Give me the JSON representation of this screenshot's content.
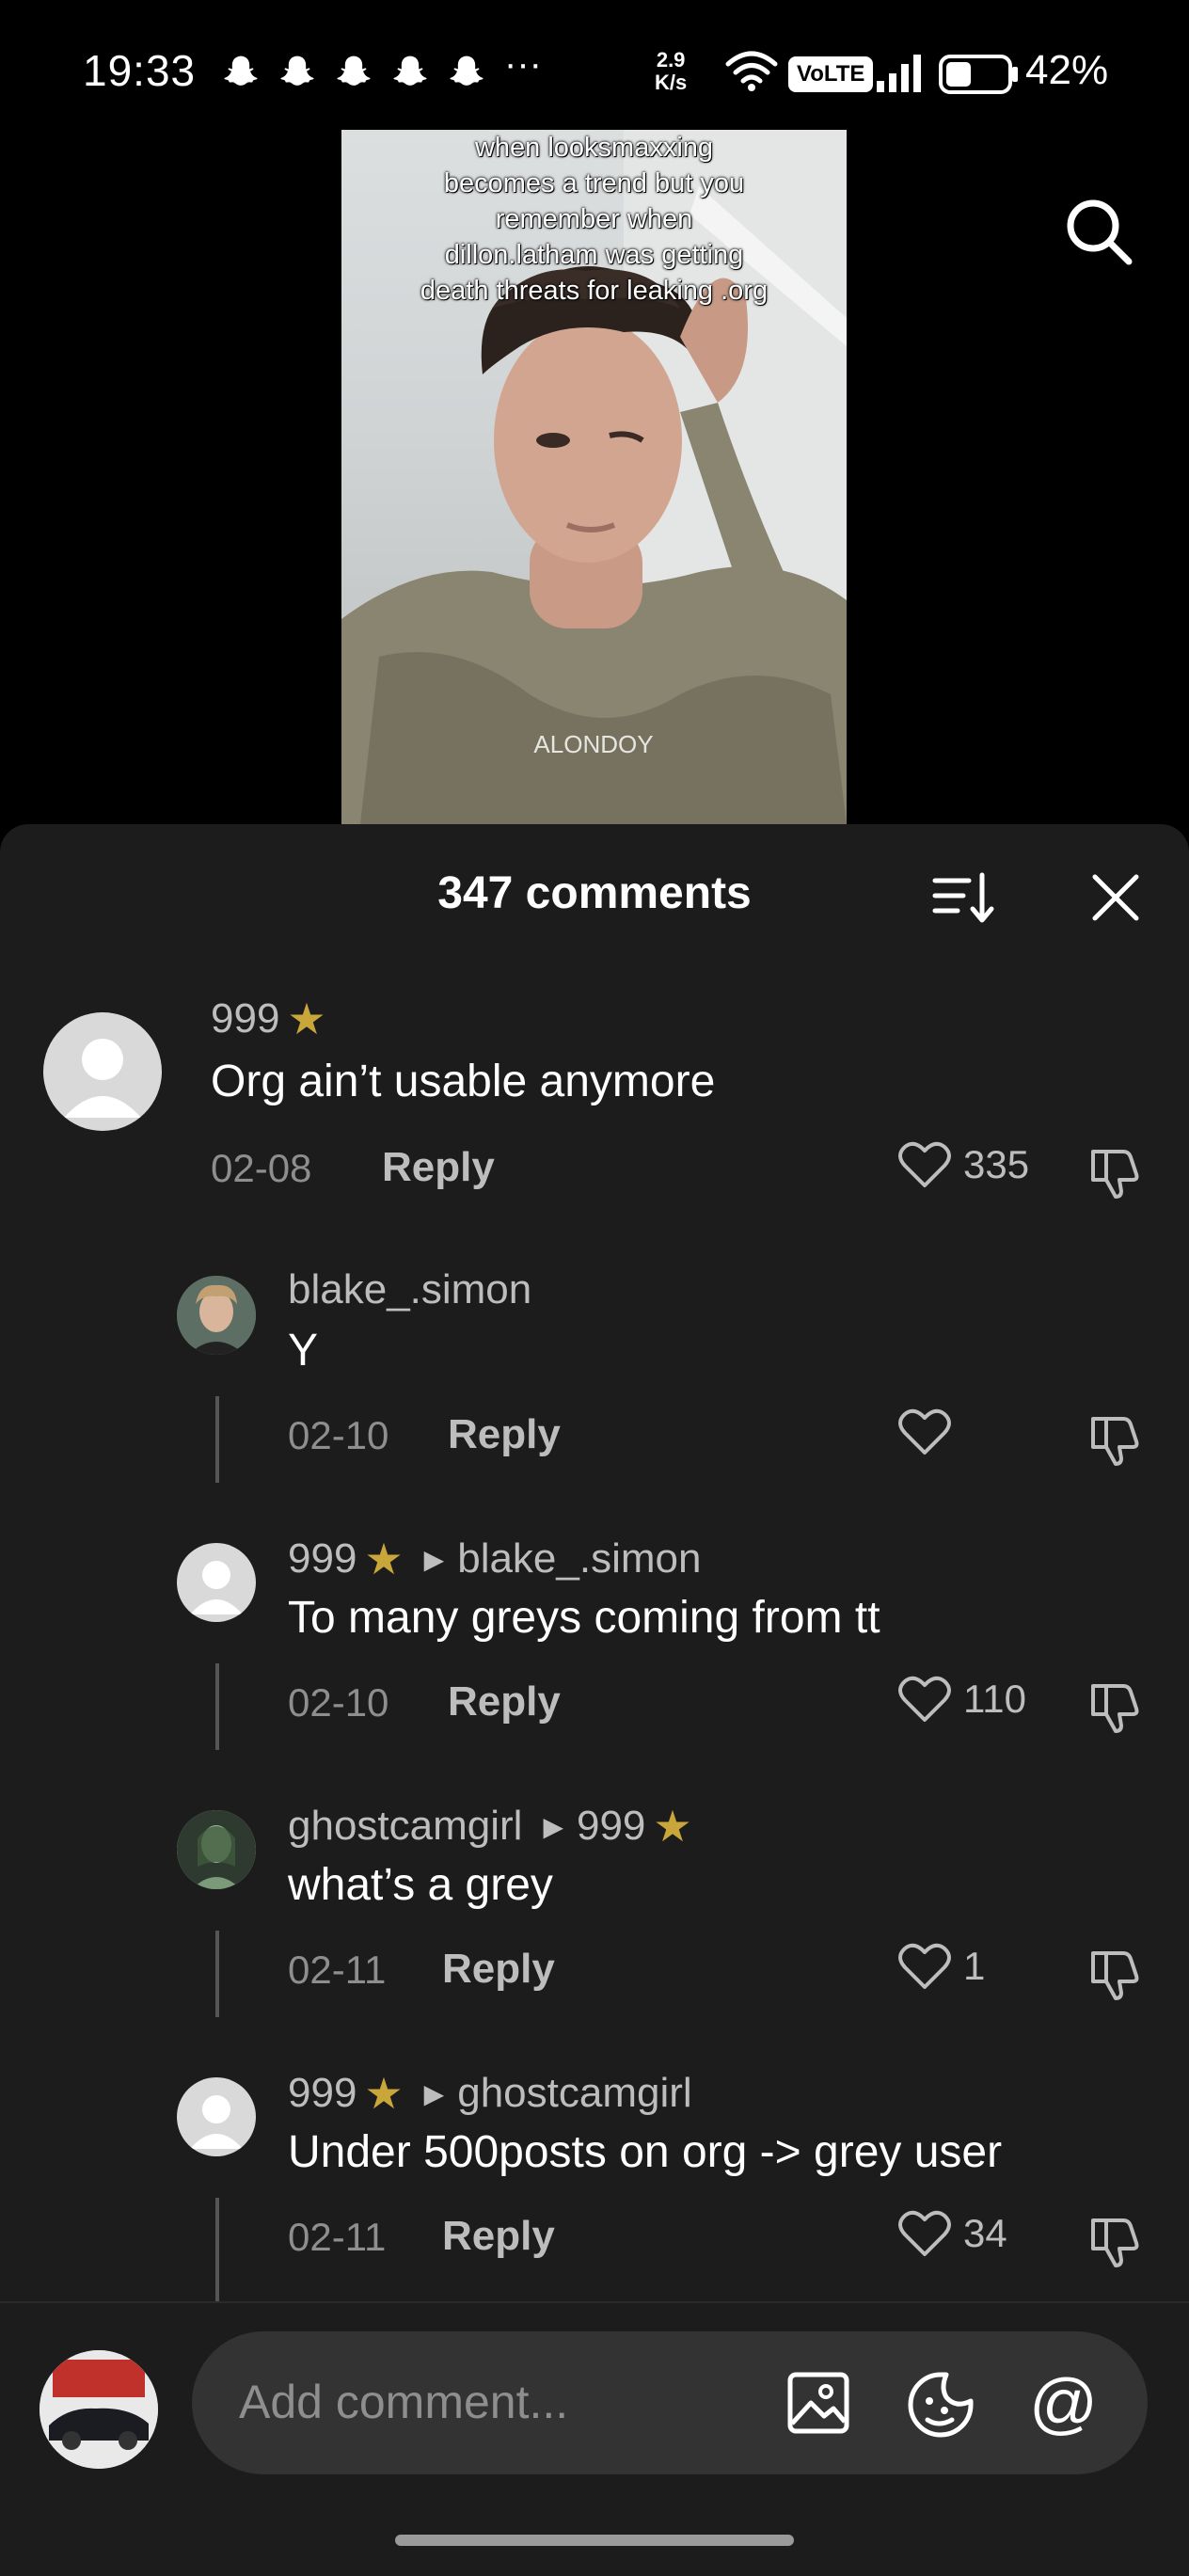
{
  "status_bar": {
    "time": "19:33",
    "more": "···",
    "net_speed_value": "2.9",
    "net_speed_unit": "K/s",
    "volte": "VoLTE",
    "battery_pct": "42%",
    "battery_level": 0.42
  },
  "video": {
    "caption": "when looksmaxxing becomes a trend but you remember when dillon.latham was getting death threats for leaking .org",
    "shirt_text": "ALONDOY"
  },
  "comments_sheet": {
    "title": "347 comments",
    "comments": [
      {
        "user": "999",
        "badge_icon": "star-icon",
        "text": "Org ain’t usable anymore",
        "date": "02-08",
        "reply_label": "Reply",
        "likes": "335"
      },
      {
        "user": "blake_.simon",
        "text": "Y",
        "date": "02-10",
        "reply_label": "Reply",
        "likes": ""
      },
      {
        "user": "999",
        "badge_icon": "star-icon",
        "reply_to": "blake_.simon",
        "text": "To many greys coming from tt",
        "date": "02-10",
        "reply_label": "Reply",
        "likes": "110"
      },
      {
        "user": "ghostcamgirl",
        "reply_to": "999",
        "reply_to_badge": "star-icon",
        "text": "what’s a grey",
        "date": "02-11",
        "reply_label": "Reply",
        "likes": "1"
      },
      {
        "user": "999",
        "badge_icon": "star-icon",
        "reply_to": "ghostcamgirl",
        "text": "Under 500posts on org -> grey user",
        "date": "02-11",
        "reply_label": "Reply",
        "likes": "34"
      }
    ]
  },
  "composer": {
    "placeholder": "Add comment...",
    "at_symbol": "@"
  },
  "colors": {
    "sheet_bg": "#1c1c1c",
    "star": "#c9a63a",
    "muted_text": "#bdbdbd"
  }
}
